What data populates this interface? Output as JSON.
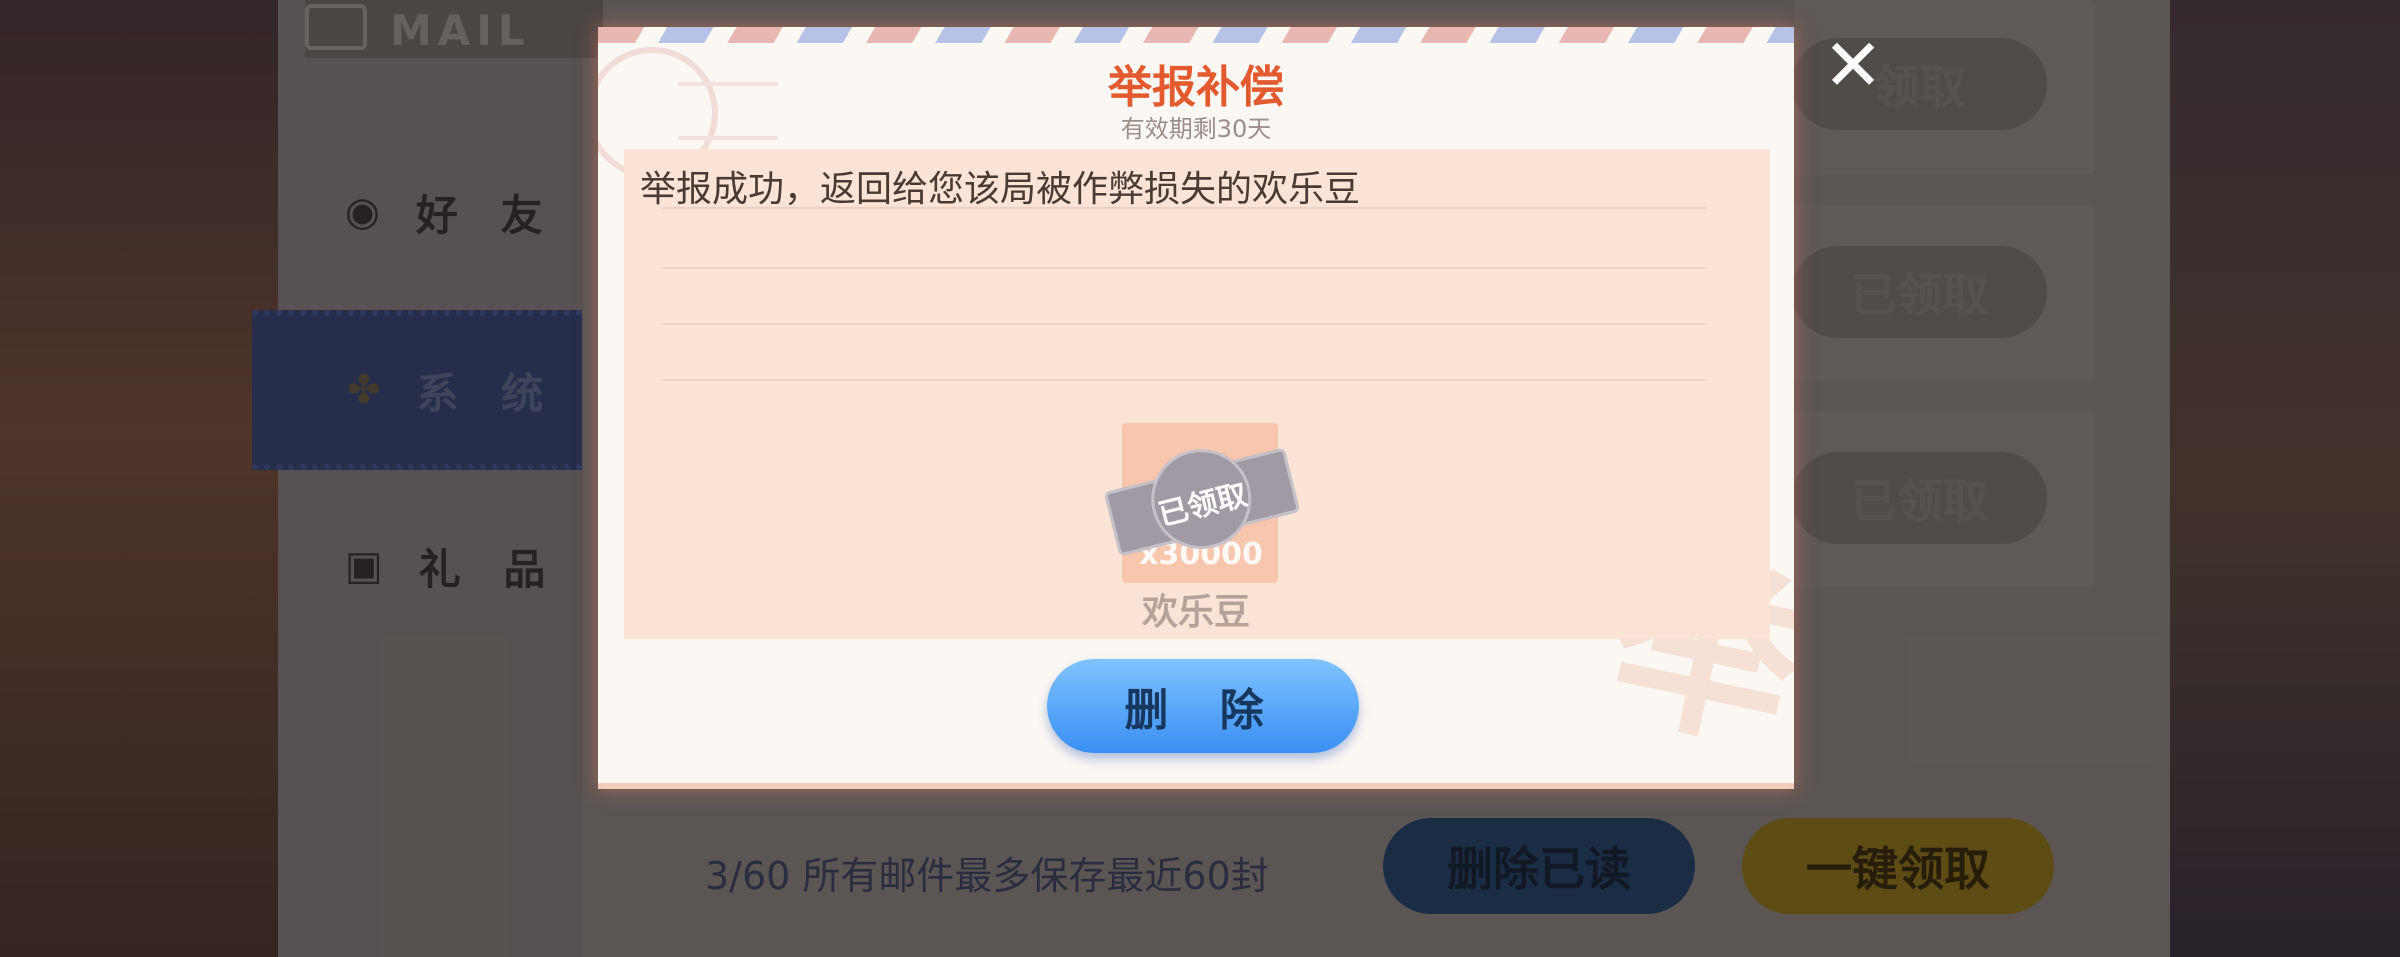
{
  "background": {
    "header": {
      "mail_label": "MAIL"
    },
    "tabs": [
      {
        "label": "好 友",
        "icon": "chat-icon"
      },
      {
        "label": "系 统",
        "icon": "clover-icon",
        "active": true
      },
      {
        "label": "礼 品",
        "icon": "gift-icon"
      }
    ],
    "right_list": {
      "claimed_labels": [
        "领取",
        "已领取",
        "已领取"
      ]
    },
    "footer": {
      "count_text": "3/60 所有邮件最多保存最近60封",
      "delete_read_label": "删除已读",
      "claim_all_label": "一键领取"
    }
  },
  "modal": {
    "title": "举报补偿",
    "subtitle": "有效期剩30天",
    "message": "举报成功，返回给您该局被作弊损失的欢乐豆",
    "reward": {
      "count": "x30000",
      "stamp": "已领取",
      "name": "欢乐豆"
    },
    "delete_label": "删 除",
    "close_icon": "✕"
  }
}
